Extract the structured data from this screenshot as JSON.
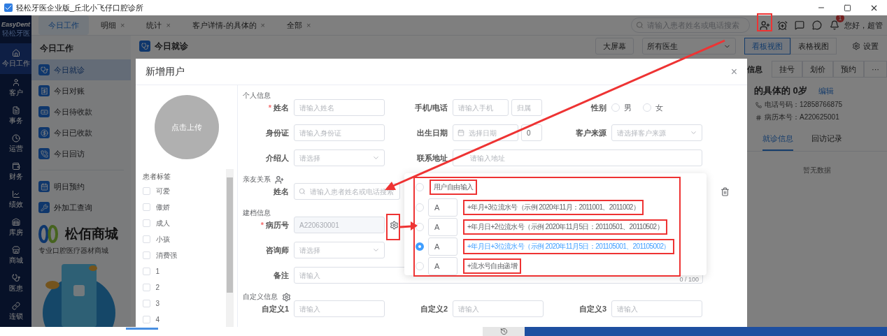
{
  "window": {
    "title": "轻松牙医企业版_丘北小飞仔口腔诊所"
  },
  "logo": {
    "name": "EasyDent",
    "subtitle": "轻松牙医"
  },
  "nav": [
    {
      "kind": "home",
      "label": "今日工作",
      "selected": true
    },
    {
      "kind": "customer",
      "label": "客户",
      "selected": false
    },
    {
      "kind": "affairs",
      "label": "事务",
      "selected": false
    },
    {
      "kind": "operations",
      "label": "运营",
      "selected": false
    },
    {
      "kind": "finance",
      "label": "财务",
      "selected": false
    },
    {
      "kind": "performance",
      "label": "绩效",
      "selected": false
    },
    {
      "kind": "warehouse",
      "label": "库房",
      "selected": false
    },
    {
      "kind": "mall",
      "label": "商城",
      "selected": false
    },
    {
      "kind": "clinic",
      "label": "医患",
      "selected": false
    },
    {
      "kind": "chain",
      "label": "连锁",
      "selected": false
    }
  ],
  "tabs": [
    {
      "label": "今日工作",
      "selected": true
    },
    {
      "label": "明细",
      "selected": false,
      "close": "×"
    },
    {
      "label": "统计",
      "selected": false,
      "close": "×"
    },
    {
      "label": "客户详情-的具体的",
      "selected": false,
      "close": "×"
    },
    {
      "label": "全部",
      "selected": false,
      "close": "×"
    }
  ],
  "search": {
    "placeholder": "请输入患者姓名或电话搜索"
  },
  "notifications": {
    "badge": "1"
  },
  "greeting": "您好，超管",
  "side_panel": {
    "title": "今日工作",
    "groups": [
      [
        {
          "kind": "visit",
          "label": "今日就诊",
          "selected": true
        },
        {
          "kind": "reconcile",
          "label": "今日对账",
          "selected": false
        },
        {
          "kind": "pending",
          "label": "今日待收款",
          "selected": false
        },
        {
          "kind": "paid",
          "label": "今日已收款",
          "selected": false
        },
        {
          "kind": "followup",
          "label": "今日回访",
          "selected": false
        }
      ],
      [
        {
          "kind": "appointment",
          "label": "明日预约",
          "selected": false
        },
        {
          "kind": "outsourcing",
          "label": "外加工查询",
          "selected": false
        }
      ]
    ]
  },
  "banner": {
    "title": "松佰商城",
    "subtitle": "专业口腔医疗器材商城"
  },
  "page": {
    "title": "今日就诊",
    "big_screen": "大屏幕",
    "doctor_select": "所有医生",
    "views": [
      {
        "label": "看板视图",
        "selected": true
      },
      {
        "label": "表格视图",
        "selected": false
      }
    ],
    "settings": "设置"
  },
  "detail_panel": {
    "title": "信息",
    "actions": [
      "挂号",
      "划价",
      "预约",
      "···"
    ],
    "name": "的具体的 0岁",
    "edit": "编辑",
    "phone": "电话号码：12858766875",
    "record": "病历本号：A220625001",
    "tabs": [
      {
        "label": "就诊信息",
        "selected": true
      },
      {
        "label": "回访记录",
        "selected": false
      }
    ],
    "empty": "暂无数据"
  },
  "dialog": {
    "title": "新增用户",
    "close": "×",
    "avatar": "点击上传",
    "tags": {
      "title": "患者标签",
      "items": [
        {
          "label": "可爱",
          "checked": false
        },
        {
          "label": "傲娇",
          "checked": false
        },
        {
          "label": "成人",
          "checked": false
        },
        {
          "label": "小孩",
          "checked": false
        },
        {
          "label": "消费强",
          "checked": false
        },
        {
          "label": "1",
          "checked": false
        },
        {
          "label": "2",
          "checked": false
        },
        {
          "label": "3",
          "checked": false
        },
        {
          "label": "4",
          "checked": false
        }
      ]
    },
    "sections": [
      {
        "kind": "personal",
        "title": "个人信息",
        "rows": [
          [
            {
              "kind": "text",
              "label": "姓名",
              "required_mark": "*",
              "placeholder": "请输入姓名"
            },
            {
              "kind": "phone",
              "label": "手机/电话",
              "placeholder": "请输入手机",
              "region_placeholder": "归属"
            },
            {
              "kind": "radio",
              "label": "性别",
              "options": [
                {
                  "label": "男",
                  "selected": false
                },
                {
                  "label": "女",
                  "selected": false
                }
              ]
            }
          ],
          [
            {
              "kind": "text",
              "label": "身份证",
              "placeholder": "请输入身份证"
            },
            {
              "kind": "date",
              "label": "出生日期",
              "placeholder": "选择日期",
              "age": "0"
            },
            {
              "kind": "select",
              "label": "客户来源",
              "placeholder": "请选择客户来源"
            }
          ],
          [
            {
              "kind": "select",
              "label": "介绍人",
              "placeholder": "请选择"
            },
            {
              "kind": "wide",
              "label": "联系地址",
              "placeholder": "请输入地址"
            }
          ]
        ]
      },
      {
        "kind": "relation",
        "title": "亲友关系",
        "rows": [
          [
            {
              "kind": "search",
              "label": "姓名",
              "placeholder": "请输入患者姓名或电话搜索"
            }
          ]
        ]
      },
      {
        "kind": "record",
        "title": "建档信息",
        "rows": [
          [
            {
              "kind": "code",
              "label": "病历号",
              "required_mark": "*",
              "value": "A220630001"
            }
          ],
          [
            {
              "kind": "select",
              "label": "咨询师",
              "placeholder": "请选择"
            }
          ],
          [
            {
              "kind": "textarea",
              "label": "备注",
              "placeholder": "请输入",
              "counter": "0 / 100"
            }
          ]
        ]
      },
      {
        "kind": "custom",
        "title": "自定义信息",
        "rows": [
          [
            {
              "kind": "text",
              "label": "自定义1",
              "placeholder": "请输入"
            },
            {
              "kind": "text",
              "label": "自定义2",
              "placeholder": "请输入"
            },
            {
              "kind": "text",
              "label": "自定义3",
              "placeholder": "请输入"
            }
          ]
        ]
      }
    ],
    "number_format": {
      "options": [
        {
          "kind": "free",
          "label": "用户自由输入",
          "selected": false
        },
        {
          "kind": "prefix",
          "prefix": "A",
          "label": "+年月+3位流水号（示例 2020年11月：2011001、2011002）",
          "selected": false
        },
        {
          "kind": "prefix",
          "prefix": "A",
          "label": "+年月日+2位流水号（示例 2020年11月5日：20110501、20110502）",
          "selected": false
        },
        {
          "kind": "prefix",
          "prefix": "A",
          "label": "+年月日+3位流水号（示例 2020年11月5日：201105001、201105002）",
          "selected": true
        },
        {
          "kind": "prefix",
          "prefix": "A",
          "label": "+流水号自由递增",
          "selected": false
        }
      ]
    }
  }
}
